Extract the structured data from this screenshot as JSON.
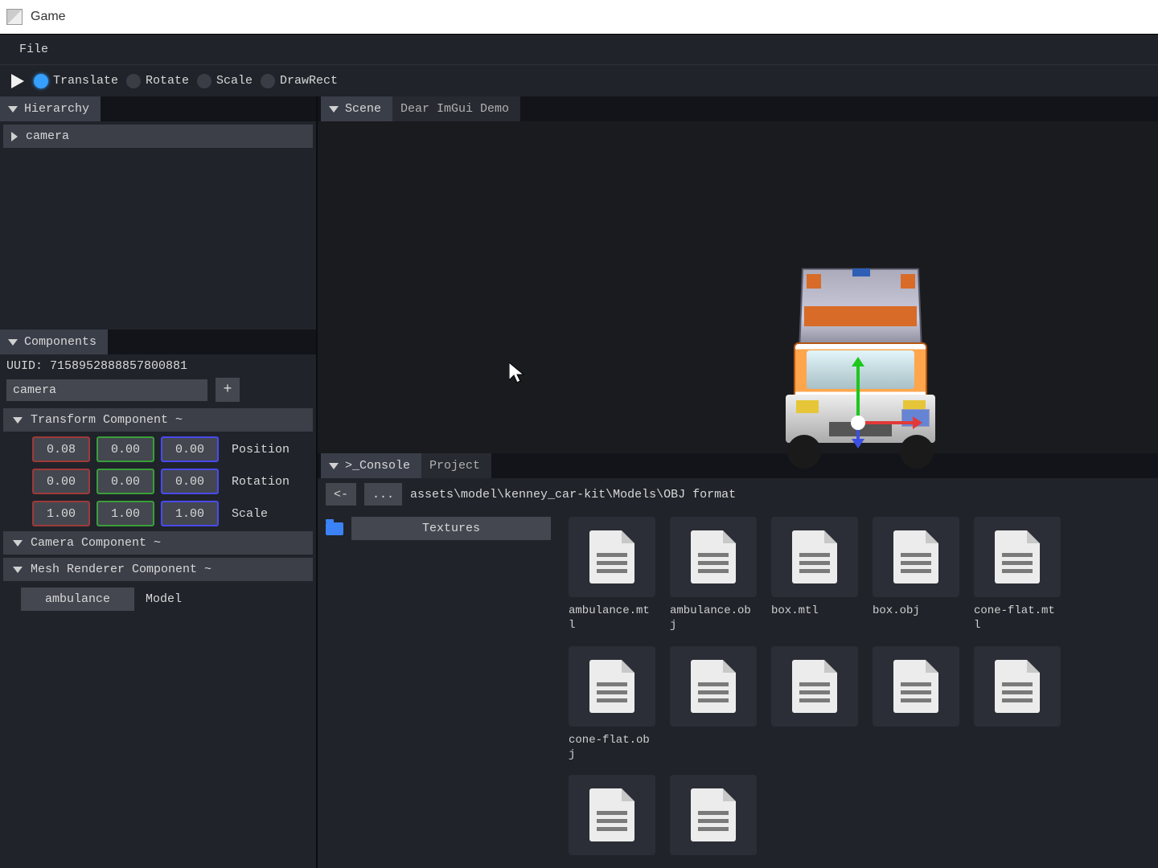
{
  "window": {
    "title": "Game"
  },
  "menubar": {
    "file": "File"
  },
  "toolbar": {
    "translate": "Translate",
    "rotate": "Rotate",
    "scale": "Scale",
    "drawrect": "DrawRect"
  },
  "hierarchy": {
    "title": "Hierarchy",
    "items": [
      {
        "label": "camera"
      }
    ]
  },
  "components": {
    "title": "Components",
    "uuid_label": "UUID: 7158952888857800881",
    "entity_name": "camera",
    "add_label": "+",
    "transform": {
      "header": "Transform Component ~",
      "position": {
        "x": "0.08",
        "y": "0.00",
        "z": "0.00",
        "label": "Position"
      },
      "rotation": {
        "x": "0.00",
        "y": "0.00",
        "z": "0.00",
        "label": "Rotation"
      },
      "scale": {
        "x": "1.00",
        "y": "1.00",
        "z": "1.00",
        "label": "Scale"
      }
    },
    "camera_header": "Camera Component ~",
    "mesh_header": "Mesh Renderer Component ~",
    "mesh_model": "ambulance",
    "mesh_model_label": "Model"
  },
  "scene": {
    "tabs": {
      "scene": "Scene",
      "demo": "Dear ImGui Demo"
    }
  },
  "project": {
    "tabs": {
      "console": ">_Console",
      "project": "Project"
    },
    "back_btn": "<-",
    "up_btn": "...",
    "path": "assets\\model\\kenney_car-kit\\Models\\OBJ format",
    "folders": [
      {
        "name": "Textures"
      }
    ],
    "files": [
      {
        "name": "ambulance.mtl"
      },
      {
        "name": "ambulance.obj"
      },
      {
        "name": "box.mtl"
      },
      {
        "name": "box.obj"
      },
      {
        "name": "cone-flat.mtl"
      },
      {
        "name": "cone-flat.obj"
      },
      {
        "name": ""
      },
      {
        "name": ""
      },
      {
        "name": ""
      },
      {
        "name": ""
      },
      {
        "name": ""
      },
      {
        "name": ""
      }
    ]
  }
}
